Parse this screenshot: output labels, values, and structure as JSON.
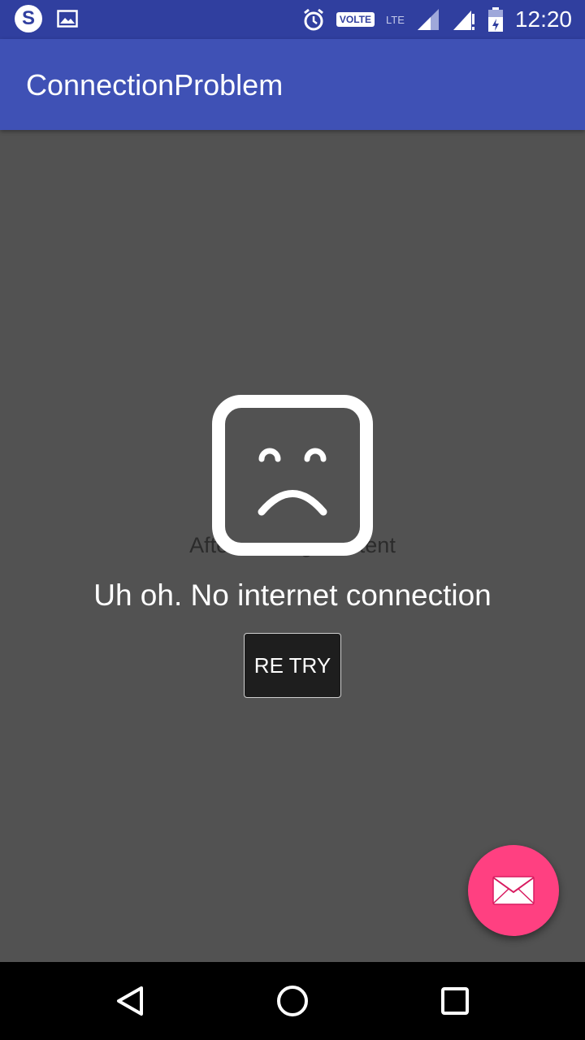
{
  "status_bar": {
    "time": "12:20",
    "volte_label": "VOLTE",
    "lte_label": "LTE",
    "skype_letter": "S",
    "icons": [
      "skype-icon",
      "image-icon",
      "alarm-icon",
      "volte-icon",
      "lte-icon",
      "signal-icon",
      "signal-alert-icon",
      "battery-charging-icon"
    ]
  },
  "app_bar": {
    "title": "ConnectionProblem"
  },
  "content": {
    "after_loading_text": "After loading Content",
    "error_icon": "sad-face-icon",
    "message": "Uh oh. No internet connection",
    "retry_label": "RE TRY"
  },
  "fab": {
    "icon": "mail-icon",
    "color": "#ff4081"
  },
  "nav_bar": {
    "icons": [
      "back-icon",
      "home-icon",
      "recents-icon"
    ]
  },
  "colors": {
    "status_bar": "#303f9f",
    "app_bar": "#3f51b5",
    "background": "#525252",
    "accent": "#ff4081"
  }
}
